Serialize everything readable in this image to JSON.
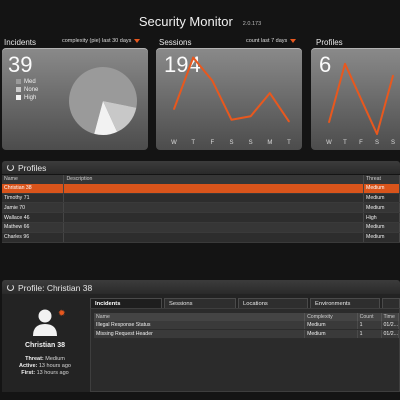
{
  "header": {
    "title": "Security Monitor",
    "version": "2.0.173"
  },
  "colors": {
    "accent": "#e8581e",
    "selected_row": "#d9541b"
  },
  "widgets": {
    "incidents": {
      "label": "Incidents",
      "filter": "complexity (pie) last 30 days",
      "count": "39",
      "legend": [
        {
          "label": "Med",
          "color": "#9a9a9a"
        },
        {
          "label": "None",
          "color": "#c8c8c8"
        },
        {
          "label": "High",
          "color": "#f2f2f2"
        }
      ]
    },
    "sessions": {
      "label": "Sessions",
      "filter": "count last 7 days",
      "count": "194",
      "days": [
        "W",
        "T",
        "F",
        "S",
        "S",
        "M",
        "T"
      ]
    },
    "profiles": {
      "label": "Profiles",
      "count": "6",
      "days": [
        "W",
        "T",
        "F",
        "S",
        "S"
      ]
    }
  },
  "chart_data": [
    {
      "type": "pie",
      "categories": [
        "Med",
        "None",
        "High"
      ],
      "values": [
        74,
        15,
        11
      ]
    },
    {
      "type": "line",
      "categories": [
        "W",
        "T",
        "F",
        "S",
        "S",
        "M",
        "T"
      ],
      "values": [
        14,
        43,
        30,
        8,
        10,
        23,
        7
      ]
    },
    {
      "type": "line",
      "categories": [
        "W",
        "T",
        "F",
        "S",
        "S"
      ],
      "values": [
        1,
        6,
        3,
        0,
        5
      ]
    }
  ],
  "profiles_panel": {
    "title": "Profiles",
    "columns": [
      "Name",
      "Description",
      "Threat"
    ],
    "rows": [
      {
        "name": "Christian 38",
        "description": "",
        "threat": "Medium",
        "selected": true
      },
      {
        "name": "Timothy 71",
        "description": "",
        "threat": "Medium"
      },
      {
        "name": "Jamie 70",
        "description": "",
        "threat": "Medium"
      },
      {
        "name": "Wallace 46",
        "description": "",
        "threat": "High"
      },
      {
        "name": "Mathew 66",
        "description": "",
        "threat": "Medium"
      },
      {
        "name": "Charles 96",
        "description": "",
        "threat": "Medium"
      }
    ]
  },
  "profile_detail": {
    "title": "Profile: Christian 38",
    "name": "Christian 38",
    "threat_label": "Threat:",
    "threat": "Medium",
    "active_label": "Active:",
    "active": "13 hours ago",
    "first_label": "First:",
    "first": "13 hours ago",
    "tabs": [
      "Incidents",
      "Sessions",
      "Locations",
      "Environments"
    ],
    "incident_columns": [
      "Name",
      "Complexity",
      "Count",
      "Time"
    ],
    "incidents": [
      {
        "name": "Illegal Response Status",
        "complexity": "Medium",
        "count": "1",
        "time": "01/2..."
      },
      {
        "name": "Missing Request Header",
        "complexity": "Medium",
        "count": "1",
        "time": "01/2..."
      }
    ]
  }
}
